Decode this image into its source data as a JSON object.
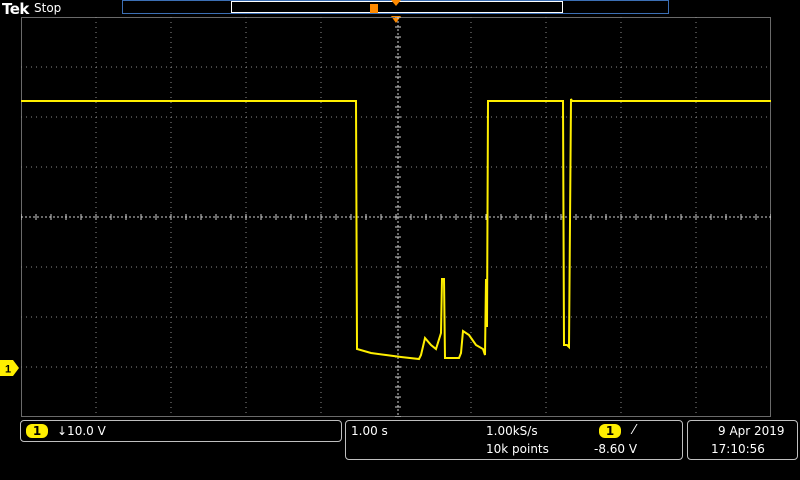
{
  "header": {
    "brand": "Tek",
    "acquisition_status": "Stop"
  },
  "channel1": {
    "label": "1",
    "scale": "↓10.0 V",
    "color": "#ffef00"
  },
  "horizontal": {
    "time_per_div": "1.00 s",
    "sample_rate": "1.00kS/s",
    "record_length": "10k points"
  },
  "trigger": {
    "source": "1",
    "slope": "⁄",
    "level": "-8.60 V",
    "color": "#ff8a00"
  },
  "datetime": {
    "date": "9 Apr  2019",
    "time": "17:10:56"
  },
  "icons": {
    "trigger_position": "trigger-position-icon",
    "channel_ground": "channel-ground-marker-icon"
  }
}
